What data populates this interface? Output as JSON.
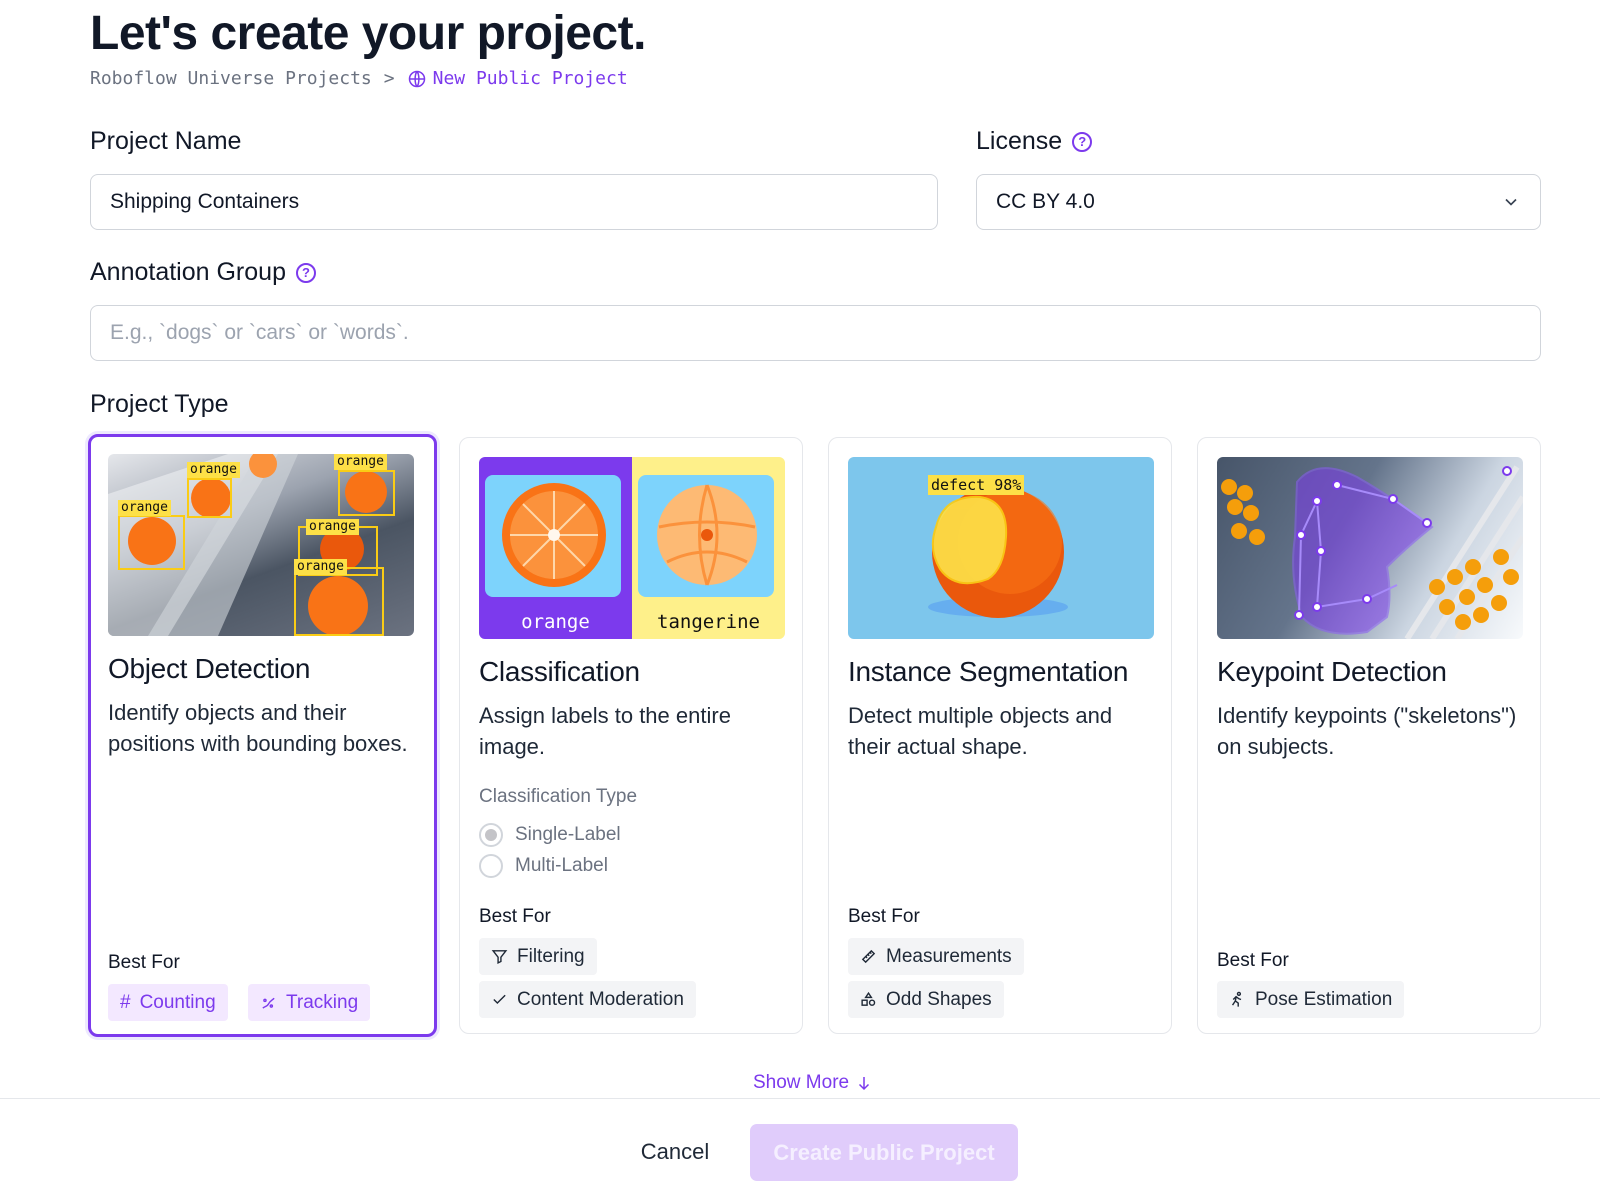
{
  "page": {
    "title": "Let's create your project.",
    "breadcrumb": {
      "parent": "Roboflow Universe Projects",
      "separator": ">",
      "current": "New Public Project"
    }
  },
  "form": {
    "project_name": {
      "label": "Project Name",
      "value": "Shipping Containers"
    },
    "license": {
      "label": "License",
      "value": "CC BY 4.0"
    },
    "annotation_group": {
      "label": "Annotation Group",
      "placeholder": "E.g., `dogs` or `cars` or `words`."
    },
    "project_type_label": "Project Type"
  },
  "cards": [
    {
      "title": "Object Detection",
      "description": "Identify objects and their positions with bounding boxes.",
      "best_for_label": "Best For",
      "chips": [
        "Counting",
        "Tracking"
      ],
      "thumb_labels": [
        "orange",
        "orange",
        "orange",
        "orange",
        "orange"
      ],
      "selected": true
    },
    {
      "title": "Classification",
      "description": "Assign labels to the entire image.",
      "classification_type_label": "Classification Type",
      "options": [
        "Single-Label",
        "Multi-Label"
      ],
      "best_for_label": "Best For",
      "chips": [
        "Filtering",
        "Content Moderation"
      ],
      "thumb_labels": [
        "orange",
        "tangerine"
      ]
    },
    {
      "title": "Instance Segmentation",
      "description": "Detect multiple objects and their actual shape.",
      "best_for_label": "Best For",
      "chips": [
        "Measurements",
        "Odd Shapes"
      ],
      "thumb_labels": [
        "defect 98%"
      ]
    },
    {
      "title": "Keypoint Detection",
      "description": "Identify keypoints (\"skeletons\") on subjects.",
      "best_for_label": "Best For",
      "chips": [
        "Pose Estimation"
      ]
    }
  ],
  "footer": {
    "show_more": "Show More",
    "cancel": "Cancel",
    "create": "Create Public Project"
  },
  "colors": {
    "accent": "#7c3aed",
    "accent_light": "#f3e8ff",
    "create_disabled": "#e0ccfb"
  }
}
